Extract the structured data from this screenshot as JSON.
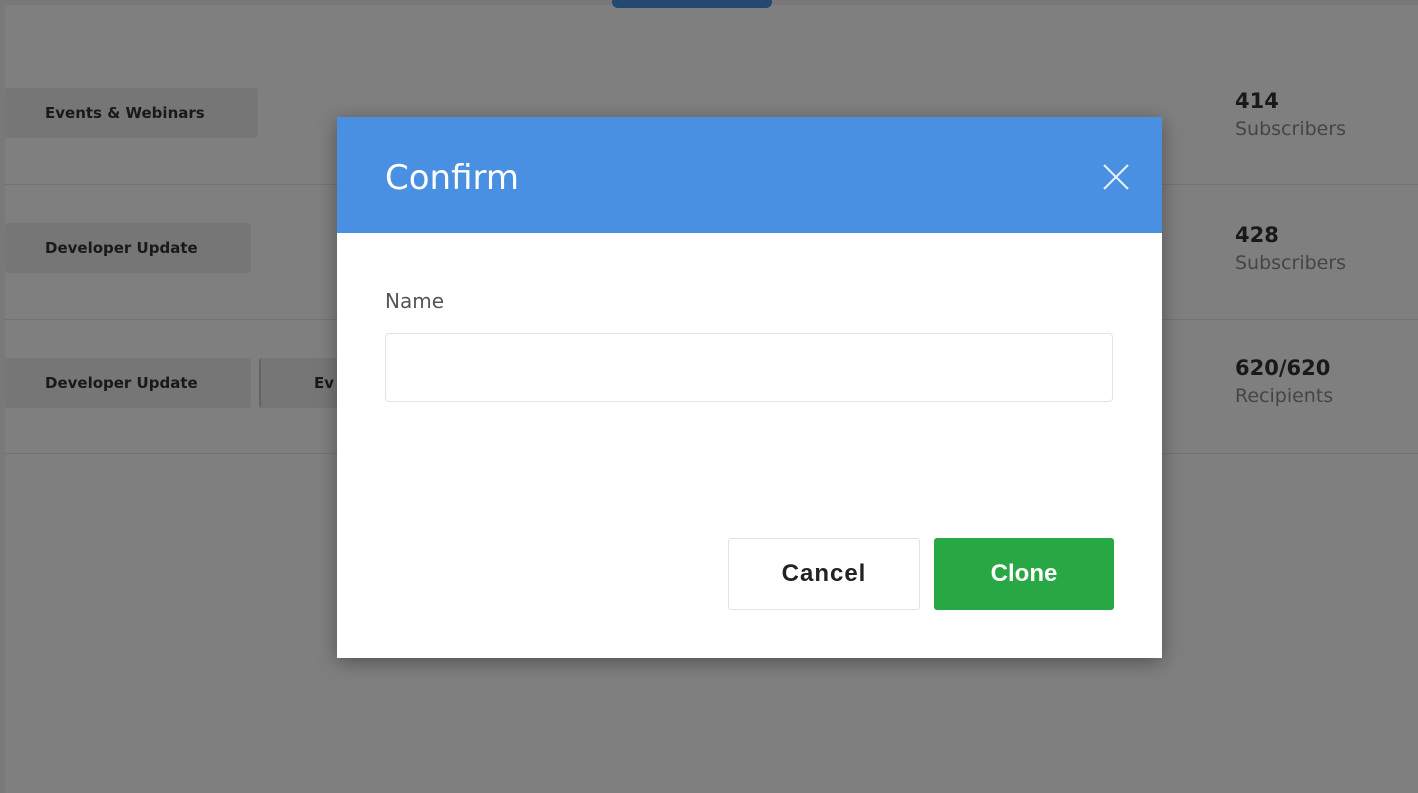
{
  "background": {
    "rows": [
      {
        "tags": [
          "Events & Webinars"
        ],
        "count": "414",
        "count_label": "Subscribers"
      },
      {
        "tags": [
          "Developer Update"
        ],
        "count": "428",
        "count_label": "Subscribers"
      },
      {
        "tags": [
          "Developer Update",
          "Ev"
        ],
        "count": "620/620",
        "count_label": "Recipients"
      }
    ]
  },
  "modal": {
    "title": "Confirm",
    "field_label": "Name",
    "name_value": "",
    "cancel_label": "Cancel",
    "clone_label": "Clone",
    "close_icon": "close-icon"
  },
  "colors": {
    "header": "#4a90e2",
    "clone_button": "#28a745"
  }
}
